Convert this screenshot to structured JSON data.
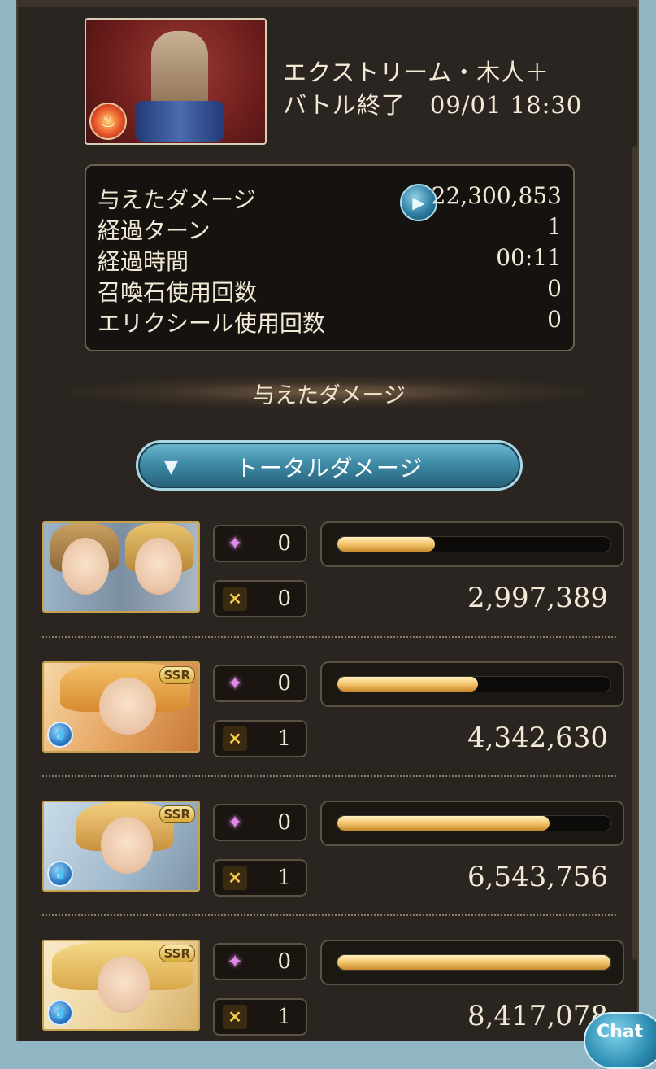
{
  "quest": {
    "name": "エクストリーム・木人＋",
    "status": "バトル終了　09/01 18:30"
  },
  "stats": [
    {
      "label": "与えたダメージ",
      "value": "22,300,853"
    },
    {
      "label": "経過ターン",
      "value": "1"
    },
    {
      "label": "経過時間",
      "value": "00:11"
    },
    {
      "label": "召喚石使用回数",
      "value": "0"
    },
    {
      "label": "エリクシール使用回数",
      "value": "0"
    }
  ],
  "section_title": "与えたダメージ",
  "dropdown": {
    "label": "トータルダメージ"
  },
  "characters": [
    {
      "ougi": "0",
      "chain": "0",
      "damage": "2,997,389",
      "bar_fraction": 0.356,
      "rarity": "",
      "element": ""
    },
    {
      "ougi": "0",
      "chain": "1",
      "damage": "4,342,630",
      "bar_fraction": 0.516,
      "rarity": "SSR",
      "element": "water-icon"
    },
    {
      "ougi": "0",
      "chain": "1",
      "damage": "6,543,756",
      "bar_fraction": 0.777,
      "rarity": "SSR",
      "element": "water-icon"
    },
    {
      "ougi": "0",
      "chain": "1",
      "damage": "8,417,078",
      "bar_fraction": 1.0,
      "rarity": "SSR",
      "element": "water-icon"
    }
  ],
  "chat": {
    "label": "Chat"
  },
  "colors": {
    "bar_fill": "#f3c46b",
    "panel_bg": "#2a2520",
    "accent_blue": "#3f8ca8"
  }
}
